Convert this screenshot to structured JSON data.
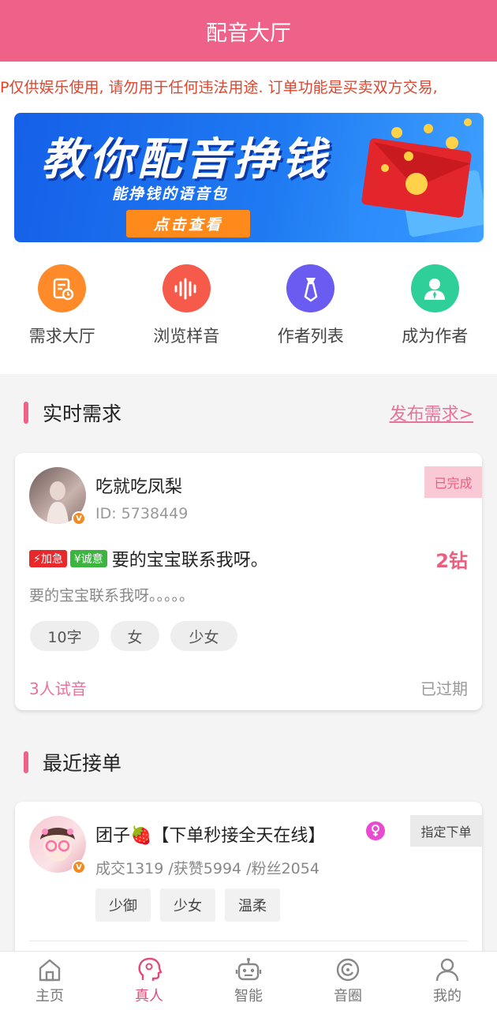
{
  "header": {
    "title": "配音大厅"
  },
  "notice": {
    "text": "P仅供娱乐使用, 请勿用于任何违法用途. 订单功能是买卖双方交易,"
  },
  "banner": {
    "title": "教你配音挣钱",
    "subtitle": "能挣钱的语音包",
    "button": "点击查看"
  },
  "quick_actions": [
    {
      "label": "需求大厅",
      "icon": "document-clock-icon",
      "color": "#ff8a2a"
    },
    {
      "label": "浏览样音",
      "icon": "sound-wave-icon",
      "color": "#f55a4a"
    },
    {
      "label": "作者列表",
      "icon": "tie-icon",
      "color": "#6a5cf0"
    },
    {
      "label": "成为作者",
      "icon": "user-icon",
      "color": "#2fcf9a"
    }
  ],
  "realtime": {
    "title": "实时需求",
    "publish_link": "发布需求>",
    "card": {
      "name": "吃就吃凤梨",
      "id_text": "ID: 5738449",
      "status": "已完成",
      "badge_urgent": "⚡加急",
      "badge_sincere": "¥诚意",
      "headline": "要的宝宝联系我呀。",
      "price": "2钻",
      "description": "要的宝宝联系我呀。。。。。",
      "chips": [
        "10字",
        "女",
        "少女"
      ],
      "trial_count": "3人试音",
      "expiry": "已过期"
    }
  },
  "recent": {
    "title": "最近接单",
    "card": {
      "name": "团子🍓【下单秒接全天在线】",
      "gender_icon": "female-icon",
      "stats": "成交1319 /获赞5994 /粉丝2054",
      "assign_button": "指定下单",
      "tags": [
        "少御",
        "少女",
        "温柔"
      ]
    }
  },
  "tabbar": [
    {
      "label": "主页",
      "icon": "home-icon",
      "active": false
    },
    {
      "label": "真人",
      "icon": "person-head-icon",
      "active": true
    },
    {
      "label": "智能",
      "icon": "robot-icon",
      "active": false
    },
    {
      "label": "音圈",
      "icon": "circle-icon",
      "active": false
    },
    {
      "label": "我的",
      "icon": "profile-icon",
      "active": false
    }
  ],
  "colors": {
    "brand": "#ee6189",
    "accent": "#e24a78",
    "notice": "#e0452d",
    "price": "#e8607f"
  }
}
